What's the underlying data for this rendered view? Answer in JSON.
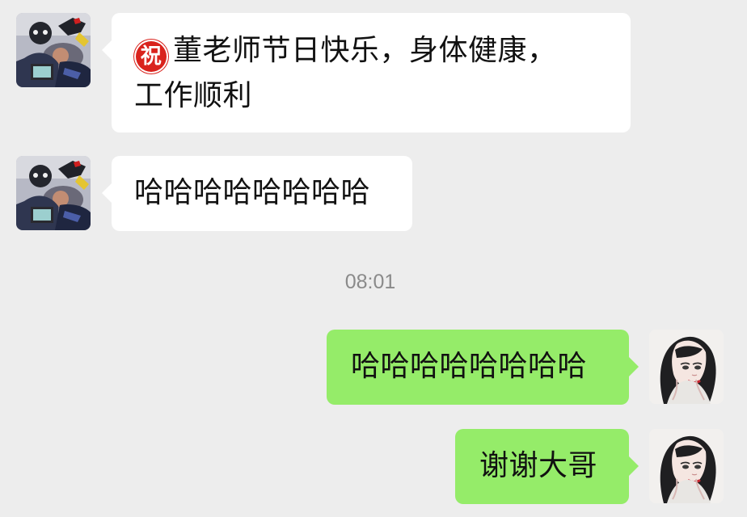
{
  "messages": [
    {
      "side": "left",
      "emoji": "祝",
      "line1": "董老师节日快乐，身体健康，",
      "line2": "工作顺利"
    },
    {
      "side": "left",
      "text": "哈哈哈哈哈哈哈哈"
    },
    {
      "side": "right",
      "text": "哈哈哈哈哈哈哈哈"
    },
    {
      "side": "right",
      "text": "谢谢大哥"
    }
  ],
  "timestamp": "08:01",
  "colors": {
    "background": "#ededed",
    "incoming_bubble": "#ffffff",
    "outgoing_bubble": "#95ec69",
    "emoji_red": "#d9231d"
  },
  "icons": {
    "left_avatar": "friend-avatar-photo",
    "right_avatar": "illustrated-girl-avatar",
    "emoji": "blessing-emoji-icon"
  }
}
